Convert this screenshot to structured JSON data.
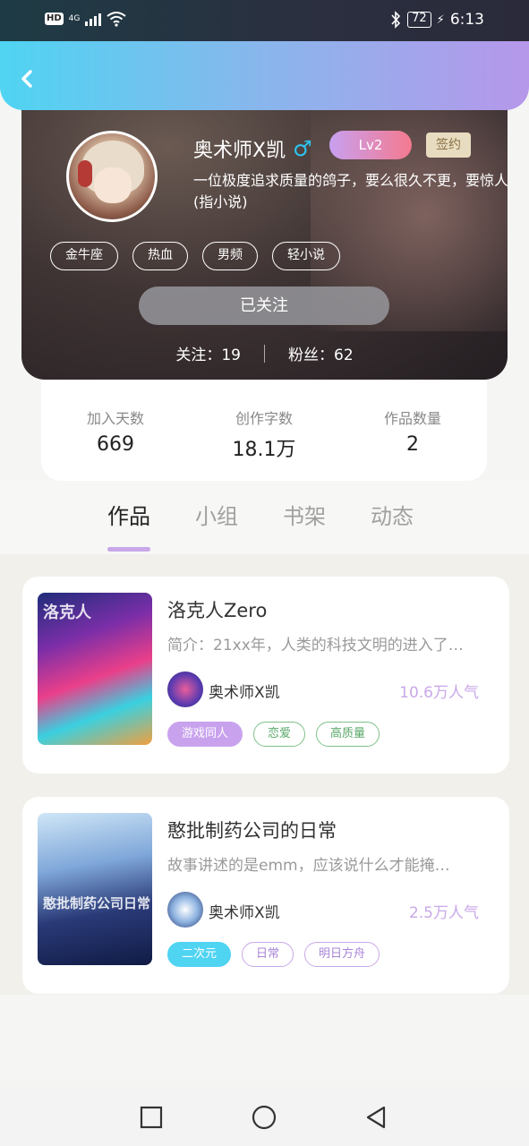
{
  "status_bar": {
    "hd_badge": "HD",
    "network": "4G",
    "battery": "72",
    "time": "6:13"
  },
  "profile": {
    "name": "奥术师X凯",
    "gender_symbol": "♂",
    "level": "Lv2",
    "signed_badge": "签约",
    "bio": "一位极度追求质量的鸽子，要么很久不更，要惊人(指小说)",
    "tags": [
      "金牛座",
      "热血",
      "男频",
      "轻小说"
    ],
    "follow_button": "已关注",
    "following_label": "关注：19",
    "followers_label": "粉丝：62"
  },
  "stats": [
    {
      "label": "加入天数",
      "value": "669"
    },
    {
      "label": "创作字数",
      "value": "18.1万"
    },
    {
      "label": "作品数量",
      "value": "2"
    }
  ],
  "tabs": [
    {
      "label": "作品",
      "active": true
    },
    {
      "label": "小组",
      "active": false
    },
    {
      "label": "书架",
      "active": false
    },
    {
      "label": "动态",
      "active": false
    }
  ],
  "books": [
    {
      "title": "洛克人Zero",
      "description": "简介：21xx年，人类的科技文明的进入了…",
      "author": "奥术师X凯",
      "popularity": "10.6万人气",
      "tags": [
        "游戏同人",
        "恋爱",
        "高质量"
      ],
      "cover_text": "洛克人"
    },
    {
      "title": "憨批制药公司的日常",
      "description": "故事讲述的是emm，应该说什么才能掩…",
      "author": "奥术师X凯",
      "popularity": "2.5万人气",
      "tags": [
        "二次元",
        "日常",
        "明日方舟"
      ],
      "cover_text": "憨批制药公司日常"
    }
  ],
  "colors": {
    "header_gradient": [
      "#4fd4f2",
      "#b697ea"
    ],
    "accent_purple": "#c9a8e8",
    "accent_cyan": "#4fd4f2",
    "accent_green": "#5aa86a"
  },
  "icons": [
    "back-arrow-icon",
    "male-icon",
    "square-nav-icon",
    "circle-nav-icon",
    "triangle-back-nav-icon",
    "wifi-icon",
    "bluetooth-icon",
    "signal-icon",
    "battery-icon"
  ]
}
